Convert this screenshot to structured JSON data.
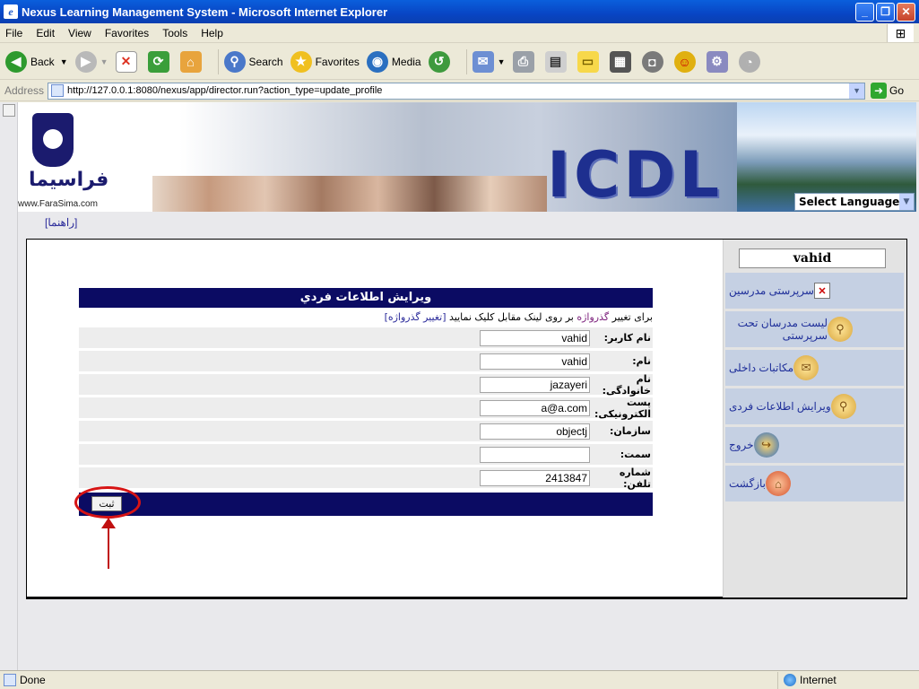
{
  "window": {
    "title": "Nexus Learning Management System - Microsoft Internet Explorer",
    "app_icon": "ie-page-icon",
    "controls": [
      "minimize",
      "maximize",
      "close"
    ]
  },
  "menu": [
    "File",
    "Edit",
    "View",
    "Favorites",
    "Tools",
    "Help"
  ],
  "toolbar": {
    "back": "Back",
    "search": "Search",
    "favorites": "Favorites",
    "media": "Media"
  },
  "address": {
    "label": "Address",
    "url": "http://127.0.0.1:8080/nexus/app/director.run?action_type=update_profile",
    "go": "Go"
  },
  "banner": {
    "logo_text": "فراسیما",
    "logo_url": "www.FaraSima.com",
    "brand": "ICDL",
    "language_select": "Select Language"
  },
  "help_link": "[راهنما]",
  "sidebar": {
    "username": "vahid",
    "items": [
      {
        "label": "سرپرستی مدرسین",
        "icon": "close-box-icon"
      },
      {
        "label": "لیست مدرسان تحت سرپرستی",
        "icon": "magnifier-icon"
      },
      {
        "label": "مکاتبات داخلی",
        "icon": "envelope-icon"
      },
      {
        "label": "ویرایش اطلاعات فردی",
        "icon": "magnifier-icon"
      },
      {
        "label": "خروج",
        "icon": "exit-icon"
      },
      {
        "label": "بازگشت",
        "icon": "home-icon"
      }
    ]
  },
  "form": {
    "title": "ويرايش اطلاعات فردي",
    "pw_prefix": "برای تغییر ",
    "pw_word": "گذرواژه",
    "pw_suffix": " بر روی لینک مقابل کلیک نمایید ",
    "pw_link": "[تغییر گذرواژه]",
    "fields": [
      {
        "label": "نام کاربر:",
        "value": "vahid"
      },
      {
        "label": "نام:",
        "value": "vahid"
      },
      {
        "label": "نام خانوادگی:",
        "value": "jazayeri"
      },
      {
        "label": "پست الکترونیکی:",
        "value": "a@a.com"
      },
      {
        "label": "سازمان:",
        "value": "objectj"
      },
      {
        "label": "سمت:",
        "value": ""
      },
      {
        "label": "شماره تلفن:",
        "value": "2413847"
      }
    ],
    "submit": "ثبت"
  },
  "status": {
    "left": "Done",
    "zone": "Internet"
  },
  "colors": {
    "form_header": "#0b0b63",
    "annotation": "#d71414",
    "sidebar_item": "#c5d0e3"
  }
}
